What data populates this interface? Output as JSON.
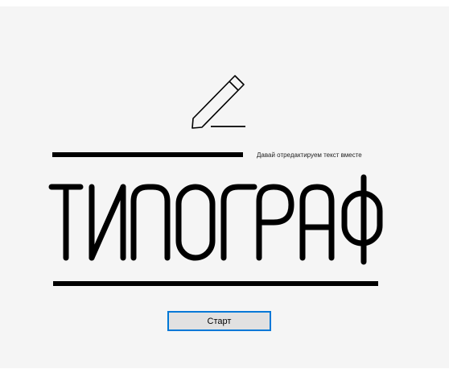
{
  "app": {
    "logo_text": "ТИПОГРАФ",
    "tagline": "Давай отредактируем текст вместе",
    "start_label": "Старт",
    "icons": [
      "pencil-icon"
    ],
    "colors": {
      "background": "#f5f5f5",
      "ink": "#000000",
      "button_fill": "#e1e1e1",
      "button_border": "#0078d7"
    }
  }
}
